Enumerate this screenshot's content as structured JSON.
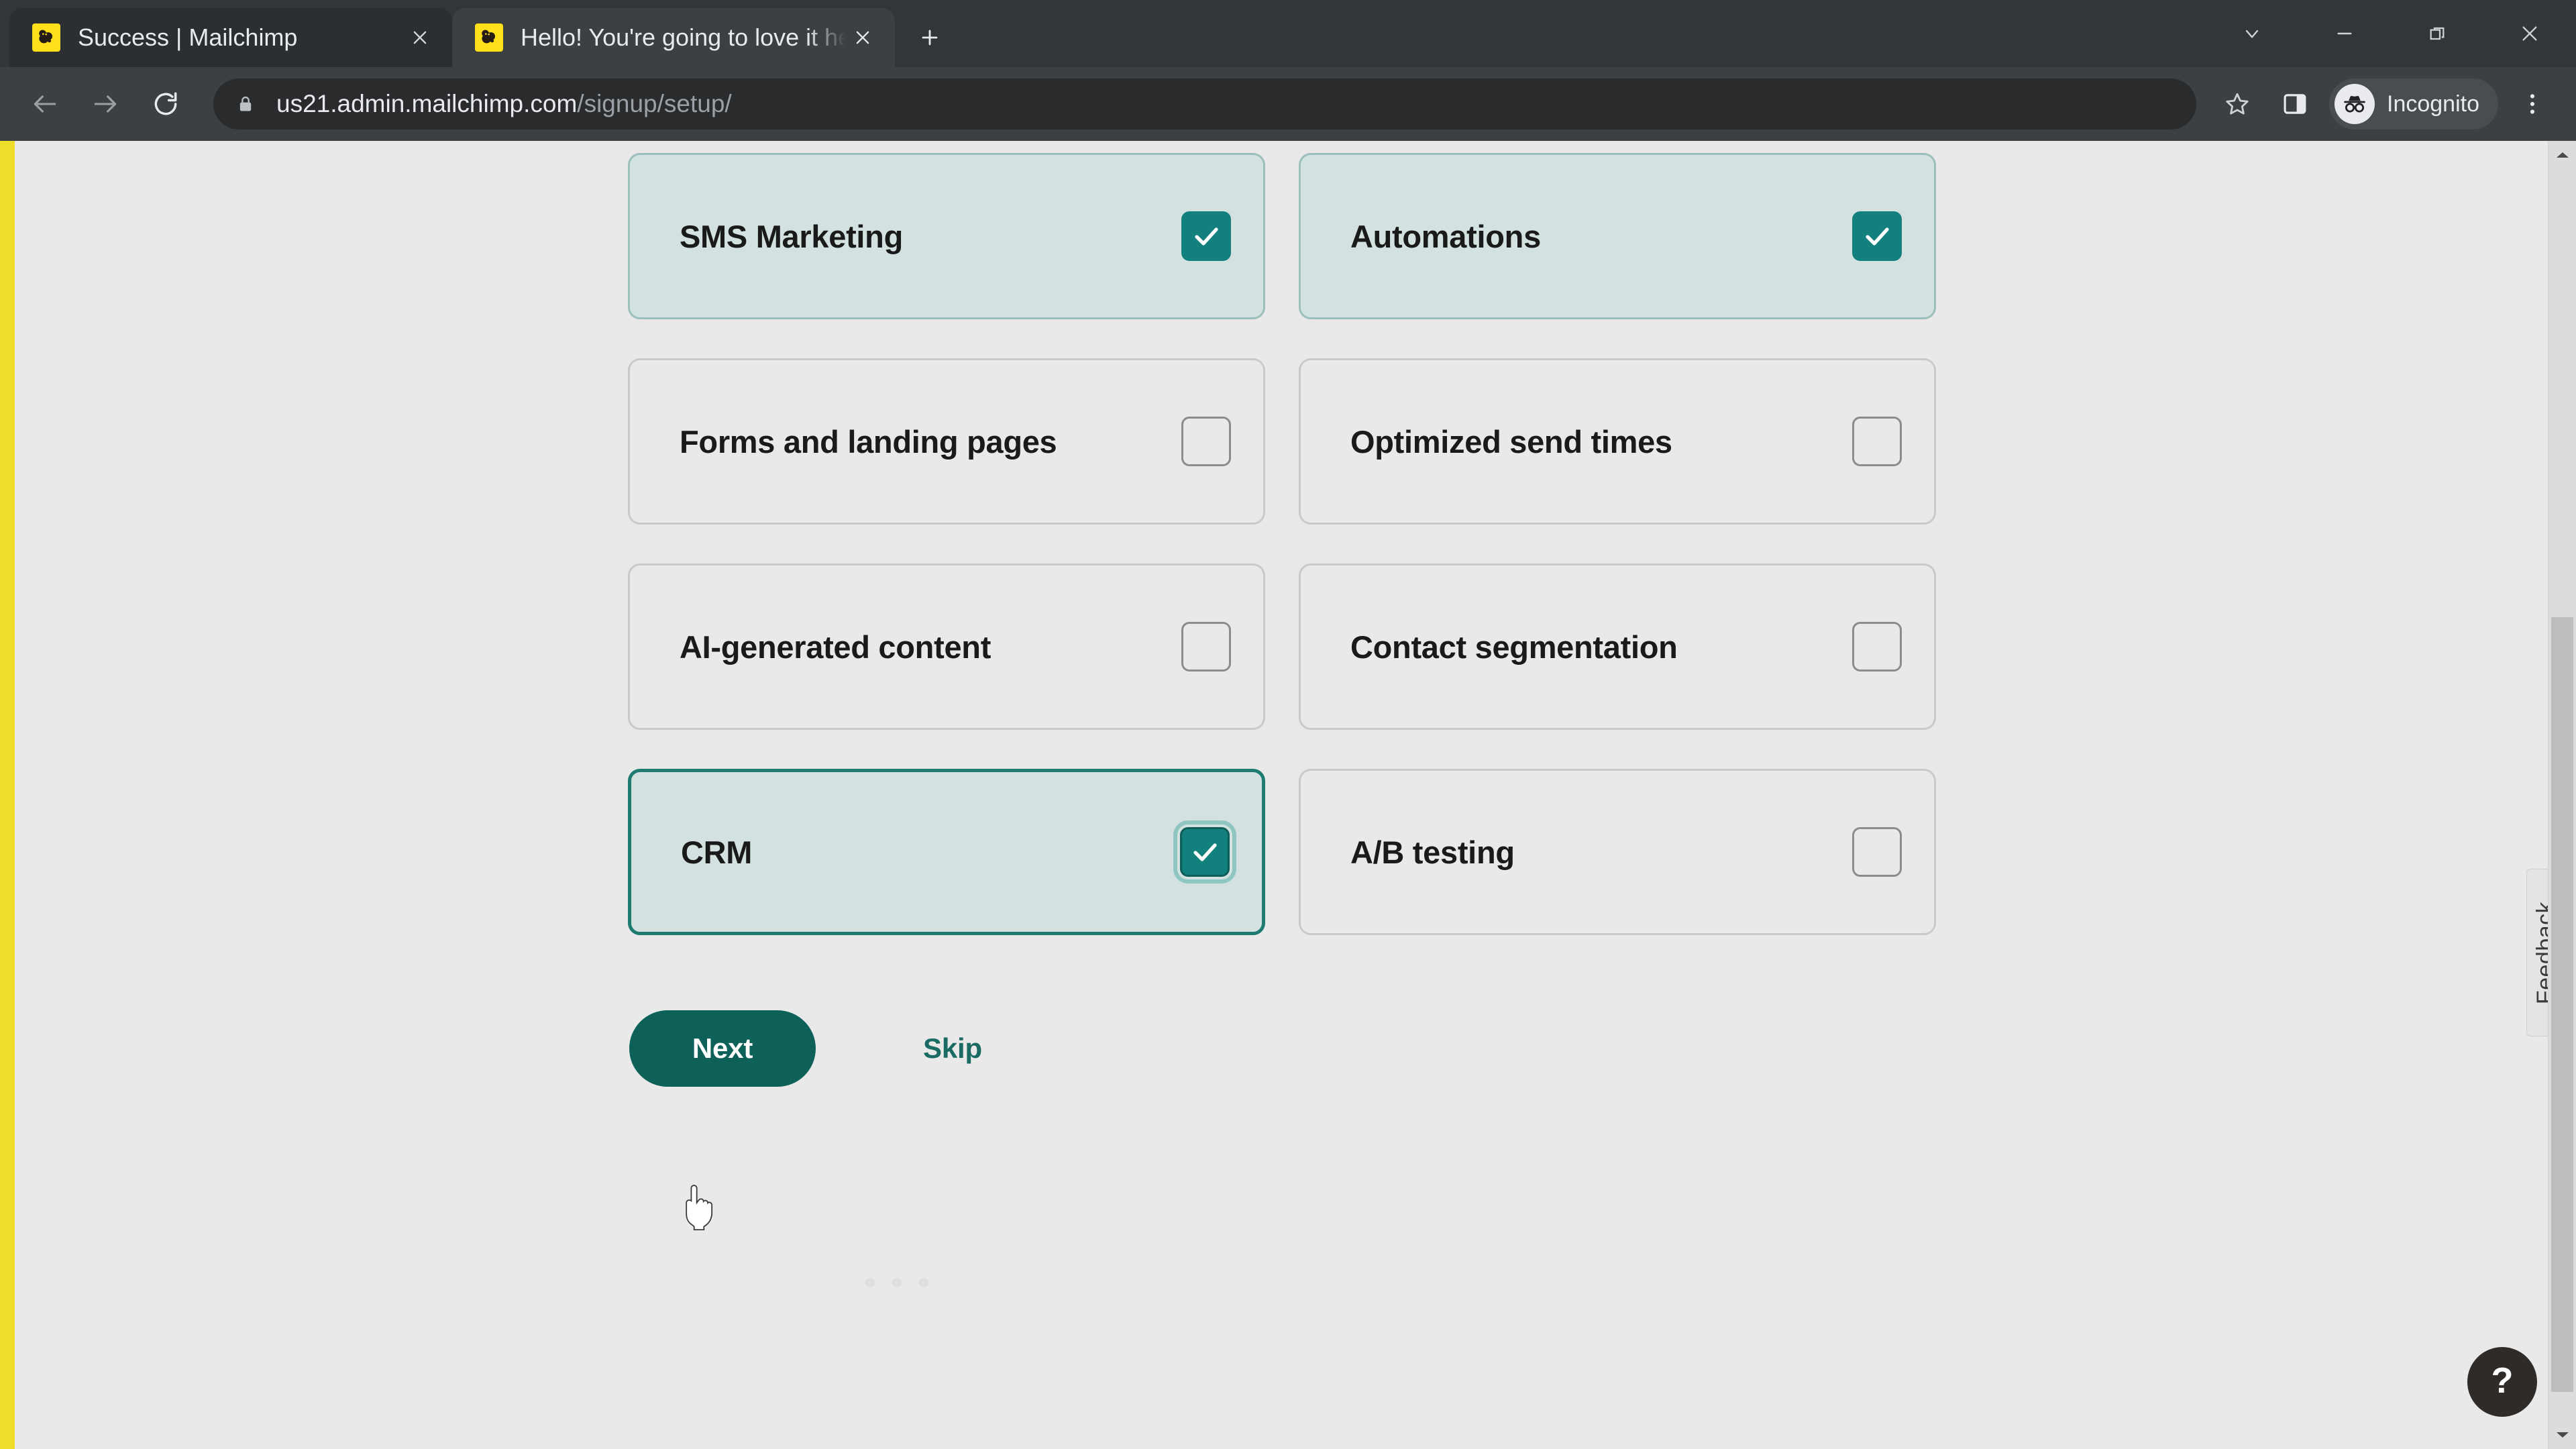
{
  "browser": {
    "tabs": [
      {
        "title": "Success | Mailchimp",
        "active": false,
        "favicon": "mailchimp-favicon"
      },
      {
        "title": "Hello! You're going to love it here",
        "active": true,
        "favicon": "mailchimp-favicon"
      }
    ],
    "new_tab_label": "+",
    "window_controls": [
      "tab-search-chevron",
      "minimize",
      "restore",
      "close"
    ],
    "toolbar": {
      "back": "back-arrow",
      "forward": "forward-arrow",
      "reload": "reload",
      "url_host": "us21.admin.mailchimp.com",
      "url_path": "/signup/setup/",
      "bookmark": "star",
      "side_panel": "side-panel",
      "profile_label": "Incognito",
      "menu": "three-dot-menu"
    }
  },
  "page": {
    "features": [
      {
        "label": "SMS Marketing",
        "checked": true,
        "focused": false
      },
      {
        "label": "Automations",
        "checked": true,
        "focused": false
      },
      {
        "label": "Forms and landing pages",
        "checked": false,
        "focused": false
      },
      {
        "label": "Optimized send times",
        "checked": false,
        "focused": false
      },
      {
        "label": "AI-generated content",
        "checked": false,
        "focused": false
      },
      {
        "label": "Contact segmentation",
        "checked": false,
        "focused": false
      },
      {
        "label": "CRM",
        "checked": true,
        "focused": true
      },
      {
        "label": "A/B testing",
        "checked": false,
        "focused": false
      }
    ],
    "next_label": "Next",
    "skip_label": "Skip",
    "feedback_label": "Feedback",
    "help_label": "?",
    "accent_teal": "#12807c",
    "button_teal": "#0d6159",
    "selected_bg": "#d3e2e0",
    "brand_yellow": "#eedd29"
  }
}
